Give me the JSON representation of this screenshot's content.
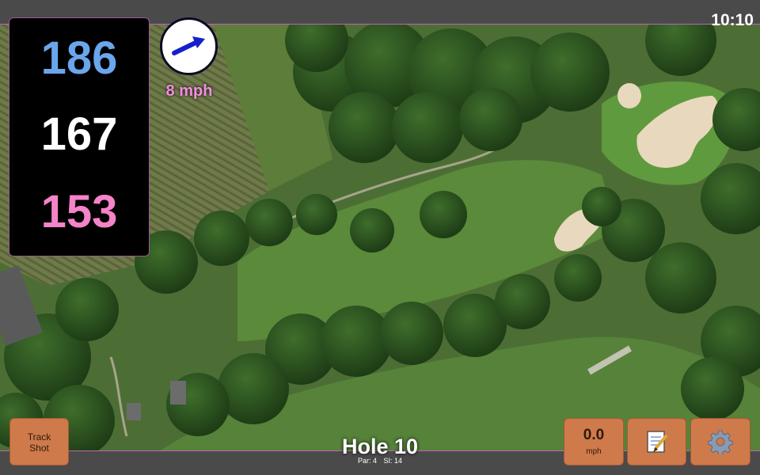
{
  "clock": "10:10",
  "distances": {
    "back": "186",
    "middle": "167",
    "front": "153"
  },
  "wind": {
    "speed_label": "8 mph",
    "icon": "wind-arrow-icon"
  },
  "buttons": {
    "track_shot_line1": "Track",
    "track_shot_line2": "Shot",
    "speed_value": "0.0",
    "speed_unit": "mph",
    "notes_icon": "memo-icon",
    "settings_icon": "gear-icon"
  },
  "hole": {
    "title": "Hole 10",
    "par": "Par: 4",
    "stroke_index": "SI: 14"
  },
  "colors": {
    "back": "#6aa6ec",
    "middle": "#ffffff",
    "front": "#f483c8",
    "wind_label": "#f48de0",
    "button": "#cf7a4a"
  }
}
